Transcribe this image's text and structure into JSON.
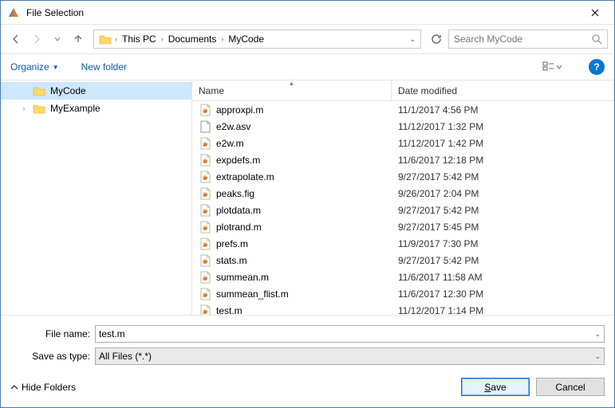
{
  "window": {
    "title": "File Selection"
  },
  "nav": {
    "breadcrumb": [
      "This PC",
      "Documents",
      "MyCode"
    ],
    "search_placeholder": "Search MyCode"
  },
  "toolbar": {
    "organize": "Organize",
    "new_folder": "New folder"
  },
  "tree": {
    "items": [
      {
        "label": "MyCode",
        "selected": true,
        "expandable": false
      },
      {
        "label": "MyExample",
        "selected": false,
        "expandable": true
      }
    ]
  },
  "columns": {
    "name": "Name",
    "date": "Date modified"
  },
  "files": [
    {
      "name": "approxpi.m",
      "date": "11/1/2017 4:56 PM",
      "type": "m"
    },
    {
      "name": "e2w.asv",
      "date": "11/12/2017 1:32 PM",
      "type": "asv"
    },
    {
      "name": "e2w.m",
      "date": "11/12/2017 1:42 PM",
      "type": "m"
    },
    {
      "name": "expdefs.m",
      "date": "11/6/2017 12:18 PM",
      "type": "m"
    },
    {
      "name": "extrapolate.m",
      "date": "9/27/2017 5:42 PM",
      "type": "m"
    },
    {
      "name": "peaks.fig",
      "date": "9/26/2017 2:04 PM",
      "type": "fig"
    },
    {
      "name": "plotdata.m",
      "date": "9/27/2017 5:42 PM",
      "type": "m"
    },
    {
      "name": "plotrand.m",
      "date": "9/27/2017 5:45 PM",
      "type": "m"
    },
    {
      "name": "prefs.m",
      "date": "11/9/2017 7:30 PM",
      "type": "m"
    },
    {
      "name": "stats.m",
      "date": "9/27/2017 5:42 PM",
      "type": "m"
    },
    {
      "name": "summean.m",
      "date": "11/6/2017 11:58 AM",
      "type": "m"
    },
    {
      "name": "summean_flist.m",
      "date": "11/6/2017 12:30 PM",
      "type": "m"
    },
    {
      "name": "test.m",
      "date": "11/12/2017 1:14 PM",
      "type": "m"
    }
  ],
  "form": {
    "file_name_label": "File name:",
    "file_name_value": "test.m",
    "save_type_label": "Save as type:",
    "save_type_value": "All Files (*.*)"
  },
  "footer": {
    "hide_folders": "Hide Folders",
    "save": "Save",
    "cancel": "Cancel"
  },
  "icons": {
    "folder_color": "#ffd968",
    "folder_stroke": "#d9a93a"
  }
}
